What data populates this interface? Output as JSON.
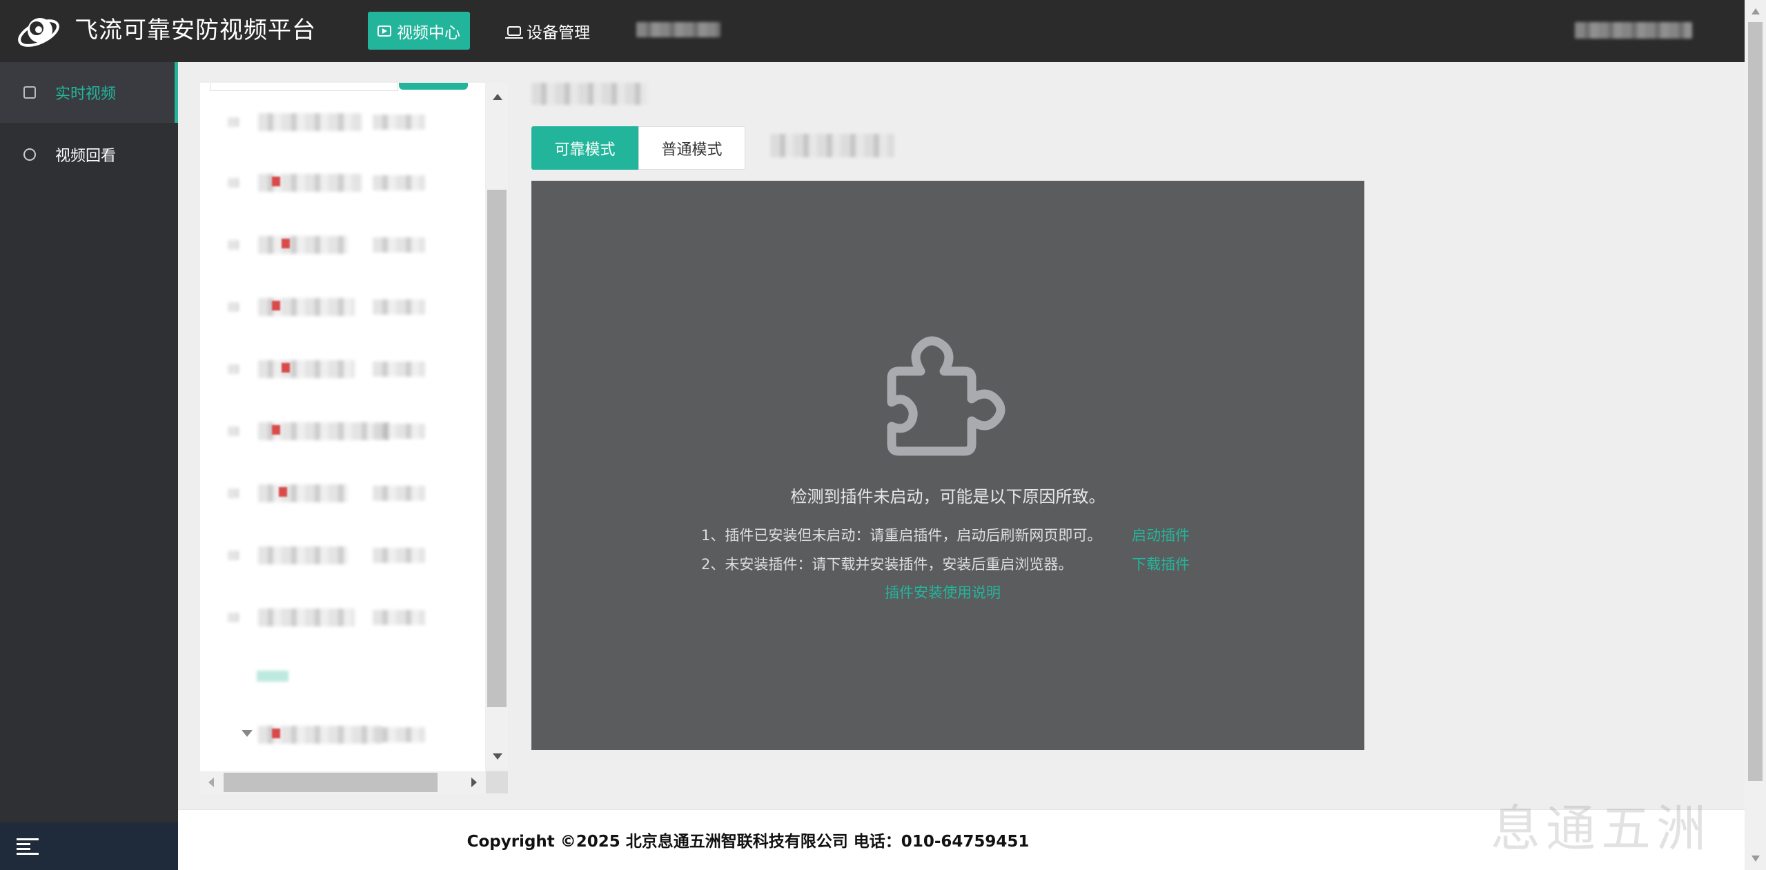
{
  "app": {
    "title": "飞流可靠安防视频平台"
  },
  "nav": {
    "items": [
      {
        "label": "视频中心",
        "icon": "play-icon",
        "active": true
      },
      {
        "label": "设备管理",
        "icon": "laptop-icon",
        "active": false
      }
    ]
  },
  "sidebar": {
    "items": [
      {
        "label": "实时视频",
        "icon": "play-icon",
        "active": true
      },
      {
        "label": "视频回看",
        "icon": "history-icon",
        "active": false
      }
    ],
    "collapse_icon": "menu-collapse-icon"
  },
  "mode_tabs": [
    {
      "label": "可靠模式",
      "active": true
    },
    {
      "label": "普通模式",
      "active": false
    }
  ],
  "plugin_message": {
    "icon": "puzzle-icon",
    "title": "检测到插件未启动，可能是以下原因所致。",
    "line1": "1、插件已安装但未启动：请重启插件，启动后刷新网页即可。",
    "line1_link": "启动插件",
    "line2": "2、未安装插件：请下载并安装插件，安装后重启浏览器。",
    "line2_link": "下载插件",
    "help_link": "插件安装使用说明"
  },
  "footer": {
    "copyright": "Copyright ©2025 北京息通五洲智联科技有限公司 电话：010-64759451"
  },
  "watermark": "息通五洲",
  "colors": {
    "accent": "#23b59b",
    "topbar": "#2b2b2b",
    "sidebar": "#2e3034",
    "video_bg": "#5b5c5e"
  }
}
